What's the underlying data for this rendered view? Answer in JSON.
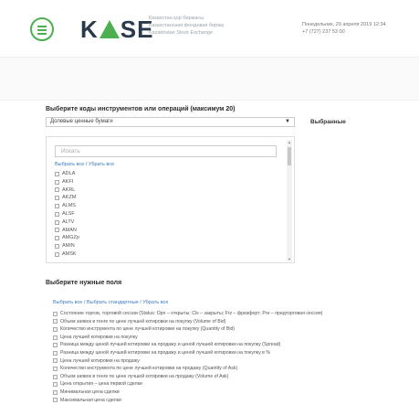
{
  "header": {
    "logo_text_left": "K",
    "logo_text_right": "SE",
    "logo_sub": [
      "Казахстан қор биржасы",
      "Казахстанская фондовая биржа",
      "Kazakhstan Stock Exchange"
    ],
    "date": "Понедельник, 29 апреля 2019 12:34",
    "phone": "+7 (727) 237 53 00",
    "accent_color": "#4caf50"
  },
  "instruments": {
    "title": "Выберите коды инструментов или операций (максимум 20)",
    "select_value": "Долевые ценные бумаги",
    "selected_title": "Выбранные",
    "search_placeholder": "Искать",
    "select_all": "Выбрать все",
    "separator": "/",
    "clear_all": "Убрать все",
    "codes": [
      "ADLA",
      "AKFI",
      "AKRL",
      "AKZM",
      "ALMS",
      "ALSF",
      "ALTV",
      "AMAN",
      "AMGZp",
      "AMIN",
      "AMSK"
    ]
  },
  "fields": {
    "title": "Выберите нужные поля",
    "select_all": "Выбрать все",
    "select_standard": "Выбрать стандартные",
    "clear_all": "Убрать все",
    "items": [
      "Состояние торгов, торговой сессии (Status: Opn – открыты; Cls – закрыты; Frz – фризфорт; Pre – предторговая сессия)",
      "Объем заявок в тенге по цене лучшей котировки на покупку (Volume of Bid)",
      "Количество инструмента по цене лучшей котировки на покупку (Quantity of Bid)",
      "Цена лучшей котировки на покупку",
      "Разница между ценой лучшей котировки на продажу и ценой лучшей котировки на покупку (Spread)",
      "Разница между ценой лучшей котировки на продажу и ценой лучшей котировки на покупку в %",
      "Цена лучшей котировки на продажу",
      "Количество инструмента по цене лучшей котировки на продажу (Quantity of Ask)",
      "Объем заявок в тенге по цене лучшей котировки на продажу (Volume of Ask)",
      "Цена открытия – цена первой сделки",
      "Минимальная цена сделки",
      "Максимальная цена сделки"
    ]
  }
}
